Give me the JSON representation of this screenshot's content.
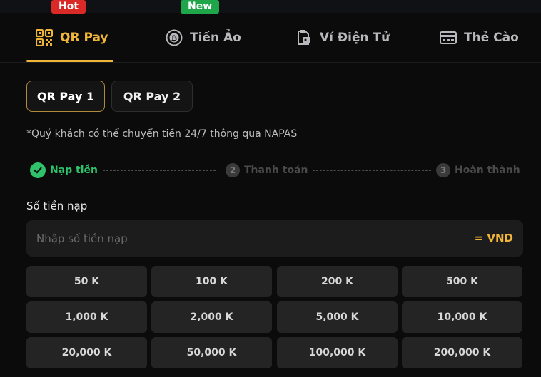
{
  "tabs": [
    {
      "label": "QR Pay",
      "icon": "qr-code-icon",
      "badge": "Hot"
    },
    {
      "label": "Tiền Ảo",
      "icon": "bitcoin-icon",
      "badge": "New"
    },
    {
      "label": "Ví Điện Tử",
      "icon": "wallet-icon",
      "badge": ""
    },
    {
      "label": "Thẻ Cào",
      "icon": "card-icon",
      "badge": ""
    }
  ],
  "subtabs": [
    {
      "label": "QR Pay 1"
    },
    {
      "label": "QR Pay 2"
    }
  ],
  "note": "*Quý khách có thể chuyển tiền 24/7 thông qua NAPAS",
  "steps": [
    {
      "label": "Nạp tiền",
      "status": "done"
    },
    {
      "label": "Thanh toán",
      "num": "2",
      "status": "todo"
    },
    {
      "label": "Hoàn thành",
      "num": "3",
      "status": "todo"
    }
  ],
  "amount": {
    "label": "Số tiền nạp",
    "placeholder": "Nhập số tiền nạp",
    "value": "",
    "unit": "= VND"
  },
  "presets": [
    "50 K",
    "100 K",
    "200 K",
    "500 K",
    "1,000 K",
    "2,000 K",
    "5,000 K",
    "10,000 K",
    "20,000 K",
    "50,000 K",
    "100,000 K",
    "200,000 K"
  ],
  "colors": {
    "accent": "#f0b63a",
    "success": "#2fc26a",
    "hot": "#d92a28",
    "new": "#1fa64a"
  }
}
